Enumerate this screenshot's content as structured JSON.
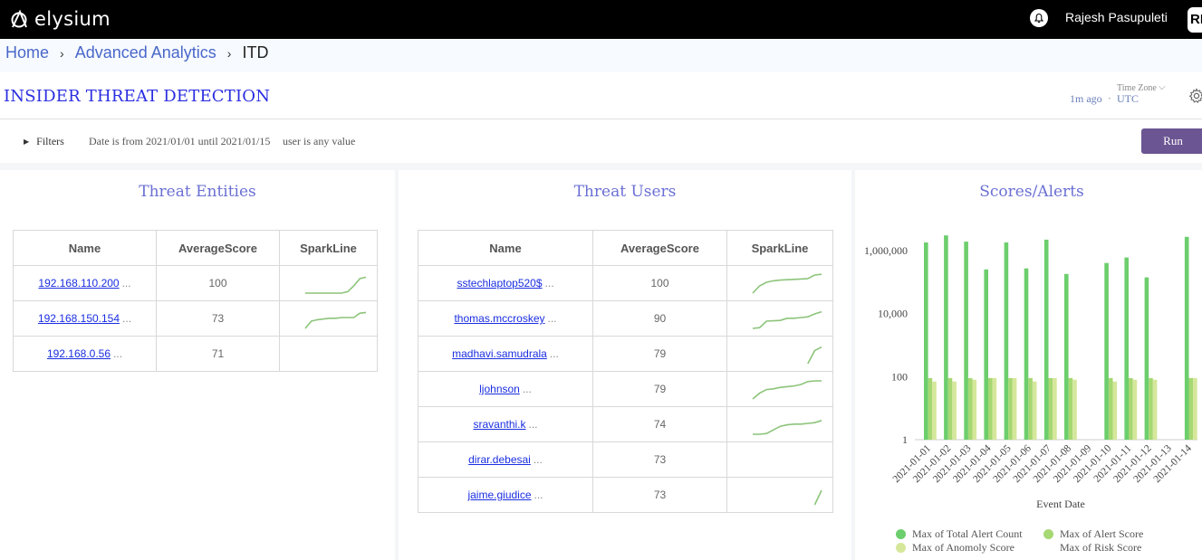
{
  "app": {
    "brand": "elysium",
    "user_name": "Rajesh Pasupuleti",
    "user_initials": "RP"
  },
  "breadcrumb": [
    {
      "label": "Home"
    },
    {
      "label": "Advanced Analytics"
    },
    {
      "label": "ITD"
    }
  ],
  "breadcrumb_sep": "›",
  "dashboard": {
    "title": "INSIDER THREAT DETECTION",
    "last_run": "1m ago",
    "timezone_label": "Time Zone",
    "timezone_value": "UTC"
  },
  "filters": {
    "toggle_label": "Filters",
    "summary_date": "Date is from 2021/01/01 until 2021/01/15",
    "summary_user": "user is any value",
    "run_label": "Run"
  },
  "colors": {
    "alert_count": "#6cce6c",
    "alert_score": "#a6d873",
    "anomaly_score": "#d5e79a",
    "risk_score": "#e8eeb2",
    "spark": "#8cc47a",
    "title": "#6a6fd3"
  },
  "threat_entities": {
    "title": "Threat Entities",
    "columns": [
      "Name",
      "AverageScore",
      "SparkLine"
    ],
    "rows": [
      {
        "name": "192.168.110.200",
        "score": "100",
        "spark": [
          1,
          1,
          1,
          1,
          1,
          1,
          1,
          1.2,
          2,
          3,
          3.2
        ]
      },
      {
        "name": "192.168.150.154",
        "score": "73",
        "spark": [
          1,
          2,
          2.2,
          2.3,
          2.4,
          2.4,
          2.5,
          2.5,
          2.5,
          3.1,
          3.2
        ]
      },
      {
        "name": "192.168.0.56",
        "score": "71",
        "spark": []
      }
    ]
  },
  "threat_users": {
    "title": "Threat Users",
    "columns": [
      "Name",
      "AverageScore",
      "SparkLine"
    ],
    "rows": [
      {
        "name": "sstechlaptop520$",
        "score": "100",
        "spark": [
          1,
          2,
          2.5,
          2.7,
          2.8,
          2.85,
          2.9,
          2.95,
          3,
          3.5,
          3.6
        ]
      },
      {
        "name": "thomas.mccroskey",
        "score": "90",
        "spark": [
          1,
          1.1,
          2,
          2.05,
          2.1,
          2.4,
          2.4,
          2.5,
          2.6,
          3,
          3.3
        ]
      },
      {
        "name": "madhavi.samudrala",
        "score": "79",
        "spark": [
          1,
          2.8,
          3.3
        ]
      },
      {
        "name": "ljohnson",
        "score": "79",
        "spark": [
          1,
          1.8,
          2.3,
          2.4,
          2.6,
          2.7,
          2.8,
          3.0,
          3.4,
          3.5,
          3.5
        ]
      },
      {
        "name": "sravanthi.k",
        "score": "74",
        "spark": [
          1,
          1,
          1.1,
          1.6,
          2.1,
          2.3,
          2.4,
          2.4,
          2.5,
          2.6,
          2.9
        ]
      },
      {
        "name": "dirar.debesai",
        "score": "73",
        "spark": []
      },
      {
        "name": "jaime.giudice",
        "score": "73",
        "spark": [
          1,
          3
        ]
      }
    ]
  },
  "scores_alerts": {
    "title": "Scores/Alerts"
  },
  "chart_data": {
    "type": "bar",
    "title": "Scores/Alerts",
    "xlabel": "Event Date",
    "ylabel": "",
    "yscale": "log",
    "ylim": [
      1,
      10000000
    ],
    "yticks": [
      "1,000,000",
      "10,000",
      "100",
      "1"
    ],
    "legend_position": "bottom",
    "categories": [
      "2021-01-01",
      "2021-01-02",
      "2021-01-03",
      "2021-01-04",
      "2021-01-05",
      "2021-01-06",
      "2021-01-07",
      "2021-01-08",
      "2021-01-09",
      "2021-01-10",
      "2021-01-11",
      "2021-01-12",
      "2021-01-13",
      "2021-01-14"
    ],
    "series": [
      {
        "name": "Max of Total Alert Count",
        "values": [
          1800000,
          3000000,
          1900000,
          250000,
          1800000,
          270000,
          2200000,
          180000,
          null,
          400000,
          600000,
          140000,
          null,
          2700000
        ]
      },
      {
        "name": "Max of Alert Score",
        "values": [
          90,
          90,
          90,
          90,
          90,
          90,
          90,
          90,
          null,
          90,
          90,
          90,
          null,
          90
        ]
      },
      {
        "name": "Max of Anomoly Score",
        "values": [
          70,
          70,
          80,
          90,
          90,
          70,
          90,
          80,
          null,
          70,
          80,
          80,
          null,
          90
        ]
      },
      {
        "name": "Max of Risk Score",
        "values": [
          null,
          null,
          null,
          null,
          null,
          null,
          null,
          null,
          null,
          null,
          null,
          null,
          null,
          null
        ]
      }
    ]
  }
}
